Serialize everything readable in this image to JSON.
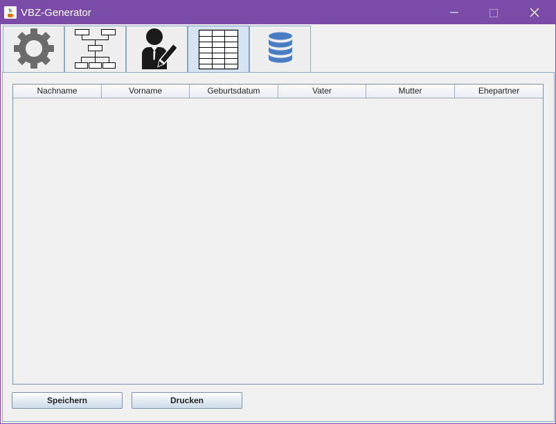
{
  "window": {
    "title": "VBZ-Generator",
    "accent_color": "#7b4ba8"
  },
  "titlebar_controls": [
    "minimize-icon",
    "maximize-icon",
    "close-icon"
  ],
  "tabs": [
    {
      "icon": "gear-icon",
      "selected": false
    },
    {
      "icon": "org-chart-icon",
      "selected": false
    },
    {
      "icon": "person-edit-icon",
      "selected": false
    },
    {
      "icon": "table-grid-icon",
      "selected": true
    },
    {
      "icon": "database-icon",
      "selected": false
    }
  ],
  "table": {
    "columns": [
      "Nachname",
      "Vorname",
      "Geburtsdatum",
      "Vater",
      "Mutter",
      "Ehepartner"
    ],
    "rows": []
  },
  "buttons": {
    "save_label": "Speichern",
    "print_label": "Drucken"
  }
}
